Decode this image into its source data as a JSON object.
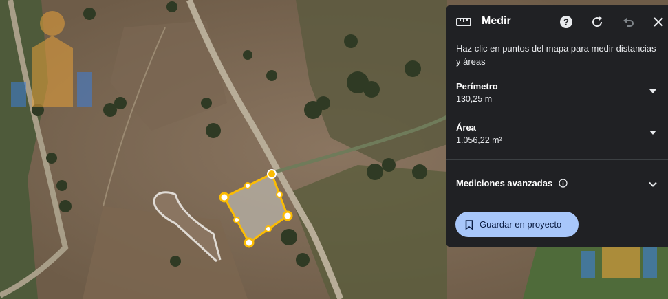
{
  "panel": {
    "title": "Medir",
    "description": "Haz clic en puntos del mapa para medir distancias y áreas",
    "perimeter_label": "Perímetro",
    "perimeter_value": "130,25 m",
    "area_label": "Área",
    "area_value": "1.056,22 m²",
    "advanced_label": "Mediciones avanzadas",
    "save_label": "Guardar en proyecto"
  },
  "icons": {
    "ruler": "ruler-icon",
    "help": "help-icon",
    "refresh": "refresh-icon",
    "undo": "undo-icon",
    "close": "close-icon",
    "info": "info-icon",
    "bookmark": "bookmark-icon",
    "chevron": "chevron-down-icon"
  },
  "colors": {
    "panel_bg": "#202124",
    "measure_line": "#fbbc04",
    "save_button": "#a8c7fa",
    "watermark_orange": "#e8a23b",
    "watermark_blue": "#3d7fd9"
  }
}
